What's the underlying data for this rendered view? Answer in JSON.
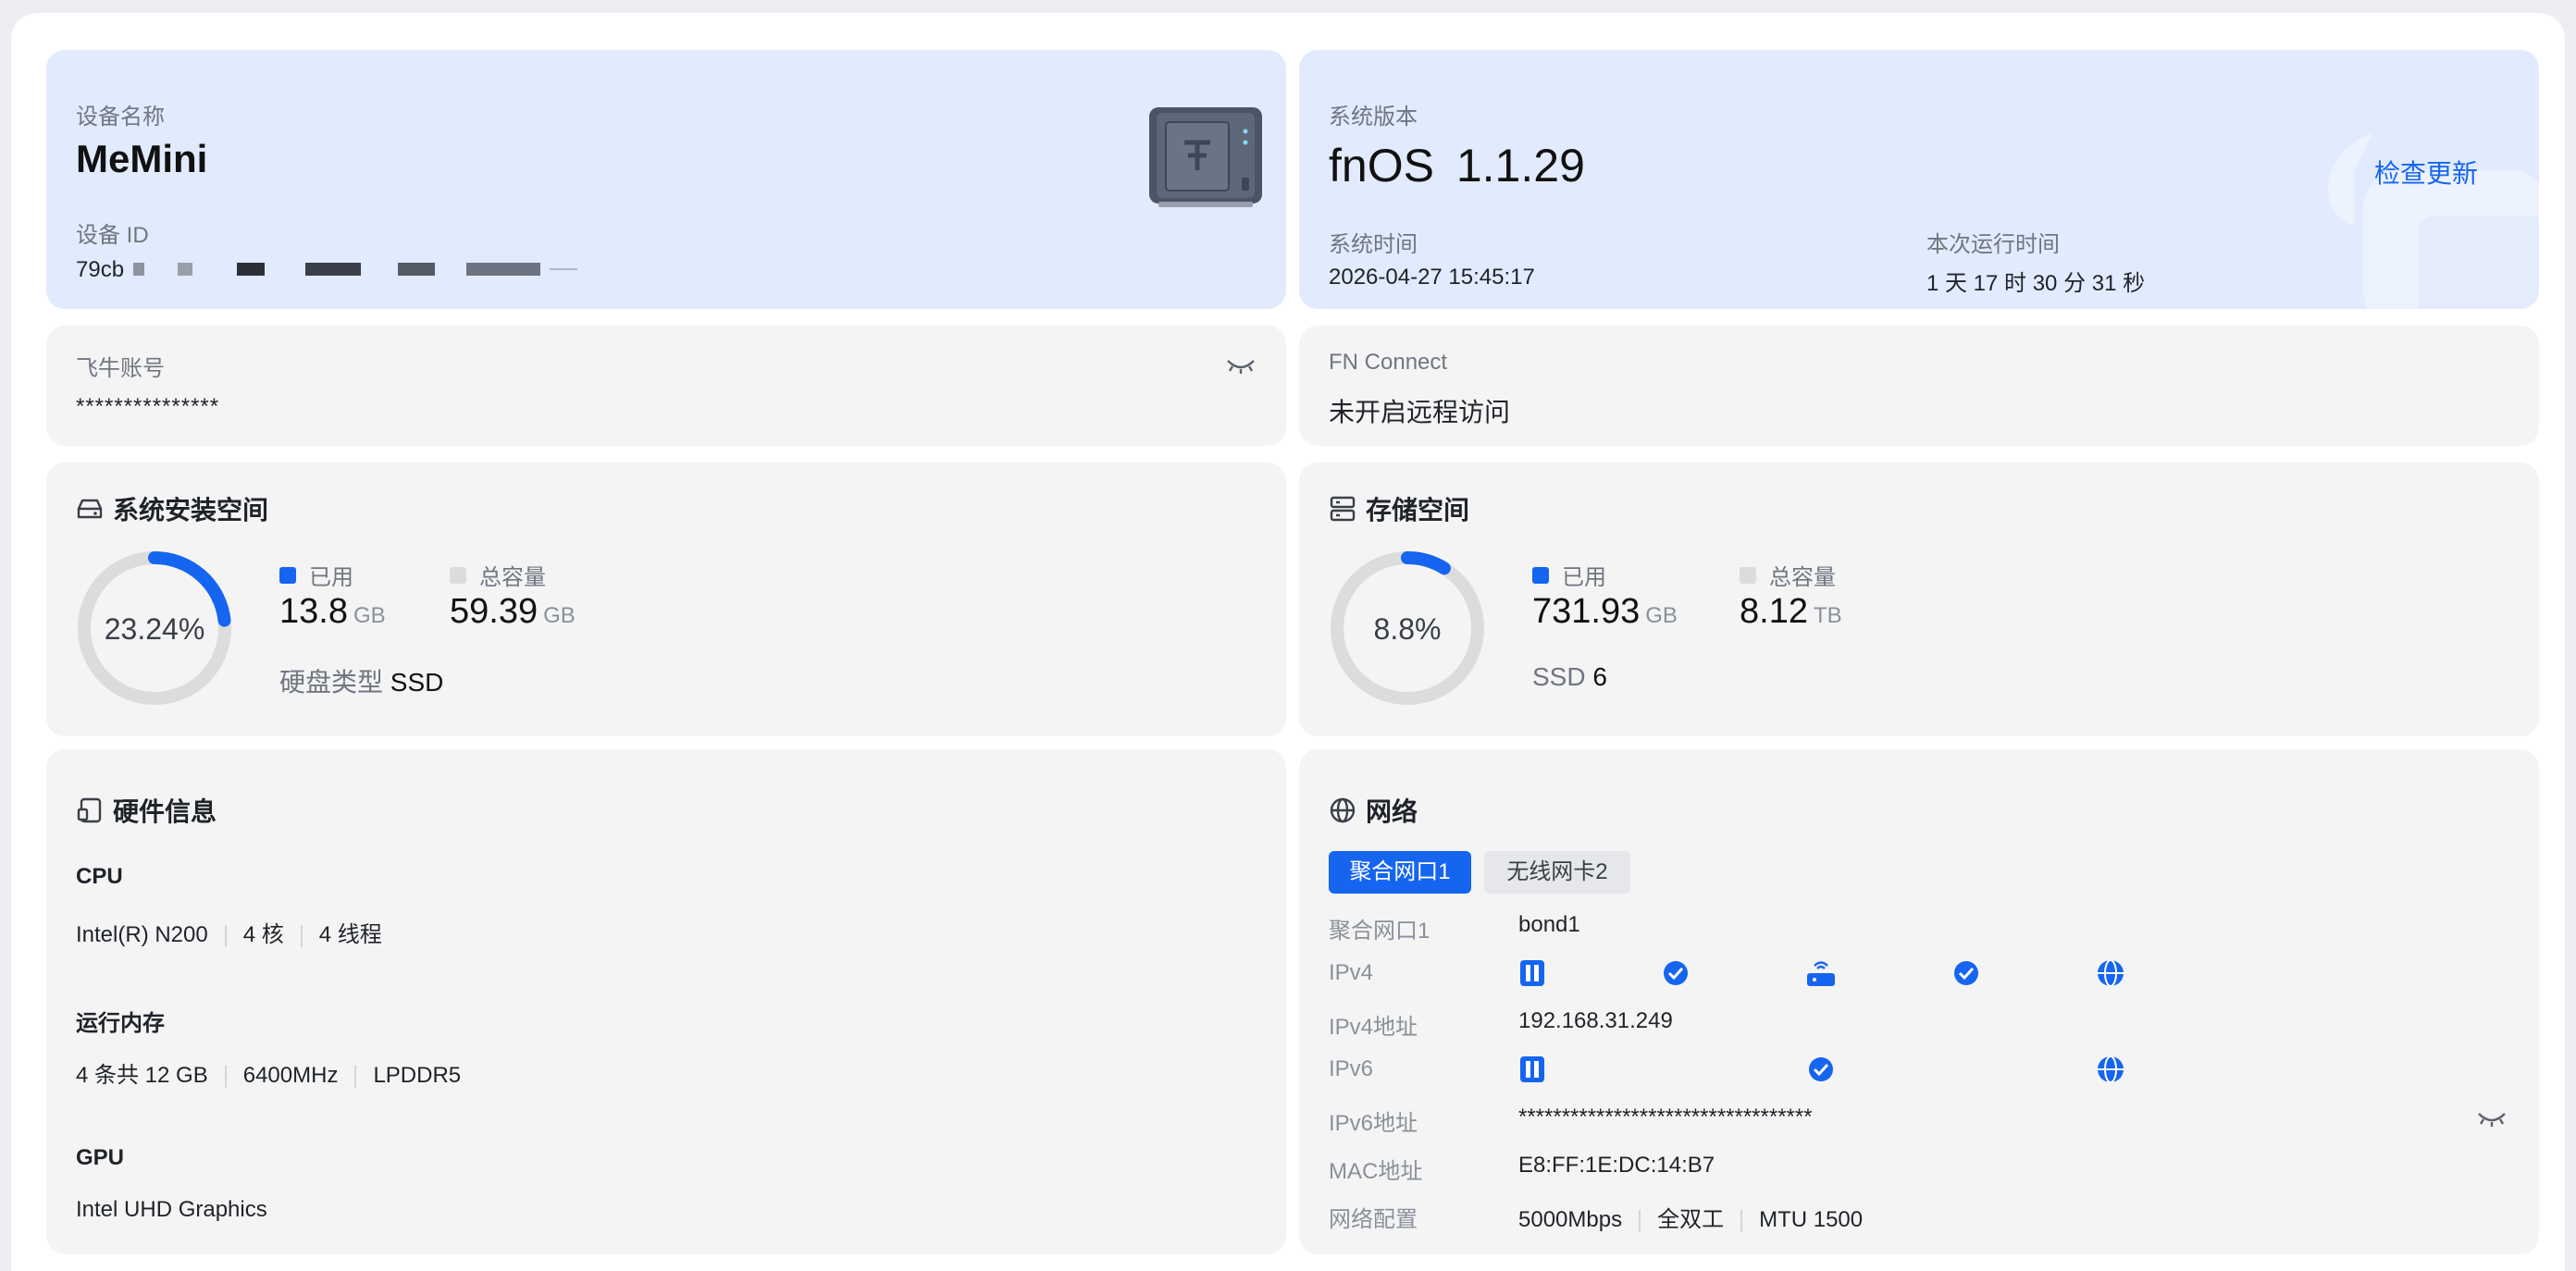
{
  "device": {
    "name_label": "设备名称",
    "name": "MeMini",
    "id_label": "设备 ID",
    "id_prefix": "79cb"
  },
  "system": {
    "version_label": "系统版本",
    "version_name": "fnOS",
    "version_number": "1.1.29",
    "check_update": "检查更新",
    "time_label": "系统时间",
    "time": "2026-04-27 15:45:17",
    "uptime_label": "本次运行时间",
    "uptime": "1 天 17 时 30 分 31 秒"
  },
  "account": {
    "label": "飞牛账号",
    "value": "***************"
  },
  "fn_connect": {
    "label": "FN Connect",
    "value": "未开启远程访问"
  },
  "system_space": {
    "title": "系统安装空间",
    "percent_label": "23.24%",
    "percent": 23.24,
    "used_label": "已用",
    "used_value": "13.8",
    "used_unit": "GB",
    "total_label": "总容量",
    "total_value": "59.39",
    "total_unit": "GB",
    "disk_type_label": "硬盘类型",
    "disk_type": "SSD"
  },
  "storage": {
    "title": "存储空间",
    "percent_label": "8.8%",
    "percent": 8.8,
    "used_label": "已用",
    "used_value": "731.93",
    "used_unit": "GB",
    "total_label": "总容量",
    "total_value": "8.12",
    "total_unit": "TB",
    "ssd_label": "SSD",
    "ssd_count": "6"
  },
  "hardware": {
    "title": "硬件信息",
    "cpu_label": "CPU",
    "cpu_model": "Intel(R) N200",
    "cpu_cores": "4 核",
    "cpu_threads": "4 线程",
    "mem_label": "运行内存",
    "mem_size": "4 条共 12 GB",
    "mem_speed": "6400MHz",
    "mem_type": "LPDDR5",
    "gpu_label": "GPU",
    "gpu_model": "Intel UHD Graphics"
  },
  "network": {
    "title": "网络",
    "tabs": [
      "聚合网口1",
      "无线网卡2"
    ],
    "iface_label": "聚合网口1",
    "iface_value": "bond1",
    "ipv4_label": "IPv4",
    "ipv4_addr_label": "IPv4地址",
    "ipv4_addr": "192.168.31.249",
    "ipv6_label": "IPv6",
    "ipv6_addr_label": "IPv6地址",
    "ipv6_addr": "**********************************",
    "mac_label": "MAC地址",
    "mac": "E8:FF:1E:DC:14:B7",
    "config_label": "网络配置",
    "speed": "5000Mbps",
    "duplex": "全双工",
    "mtu": "MTU 1500"
  },
  "colors": {
    "accent": "#1565f0",
    "card_bg": "#f4f4f5",
    "card_blue": "#e1ebfd",
    "ring_track": "#dcdcdc"
  }
}
